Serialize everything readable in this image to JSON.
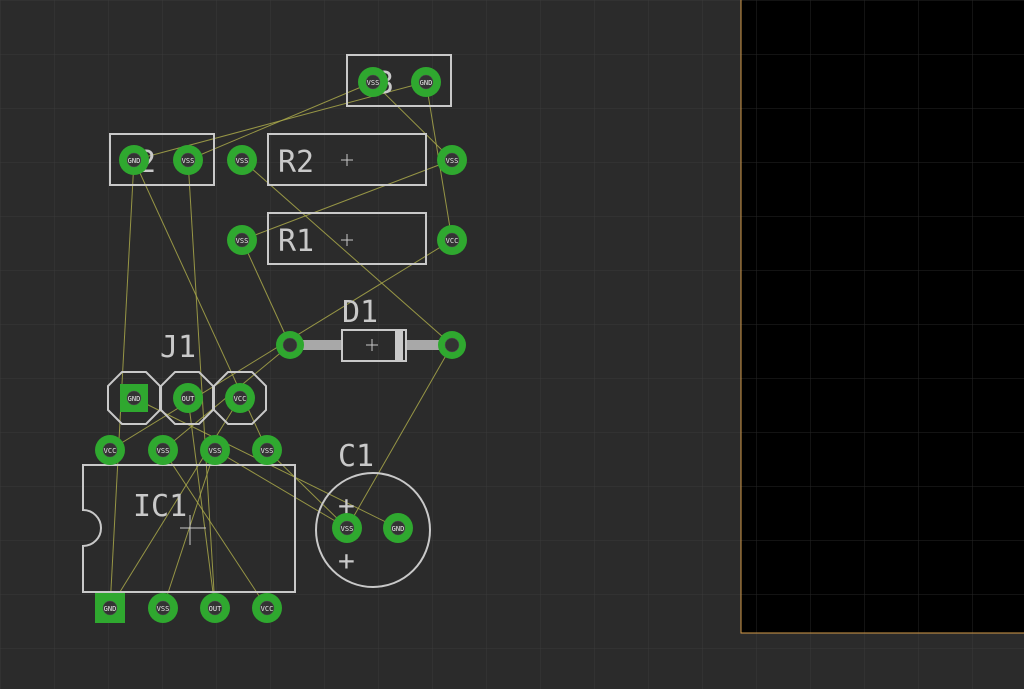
{
  "view": {
    "board_background": "#000000",
    "canvas_background": "#2b2b2b",
    "grid_color": "#3a3a3a",
    "board_grid_color": "#2e2e2e",
    "board_edge_color": "#d49b4a",
    "pad_color": "#2fa82f",
    "silk_color": "#c9c9c9",
    "ratsnest_color": "#a9a84a"
  },
  "components": {
    "c3": {
      "ref": "C3",
      "pad1_net": "VSS",
      "pad2_net": "GND"
    },
    "c2": {
      "ref": "C2",
      "pad1_net": "GND",
      "pad2_net": "VSS"
    },
    "r2": {
      "ref": "R2",
      "pad1_net": "VSS",
      "pad2_net": "VSS"
    },
    "r1": {
      "ref": "R1",
      "pad1_net": "VSS",
      "pad2_net": "VCC"
    },
    "d1": {
      "ref": "D1"
    },
    "j1": {
      "ref": "J1",
      "pad1_net": "GND",
      "pad2_net": "OUT",
      "pad3_net": "VCC"
    },
    "ic1": {
      "ref": "IC1",
      "top_pins": [
        "VCC",
        "VSS",
        "VSS",
        "VSS"
      ],
      "bottom_pins": [
        "GND",
        "VSS",
        "OUT",
        "VCC"
      ]
    },
    "c1": {
      "ref": "C1",
      "pad1_net": "VSS",
      "pad2_net": "GND",
      "plus_sign": "+"
    }
  }
}
